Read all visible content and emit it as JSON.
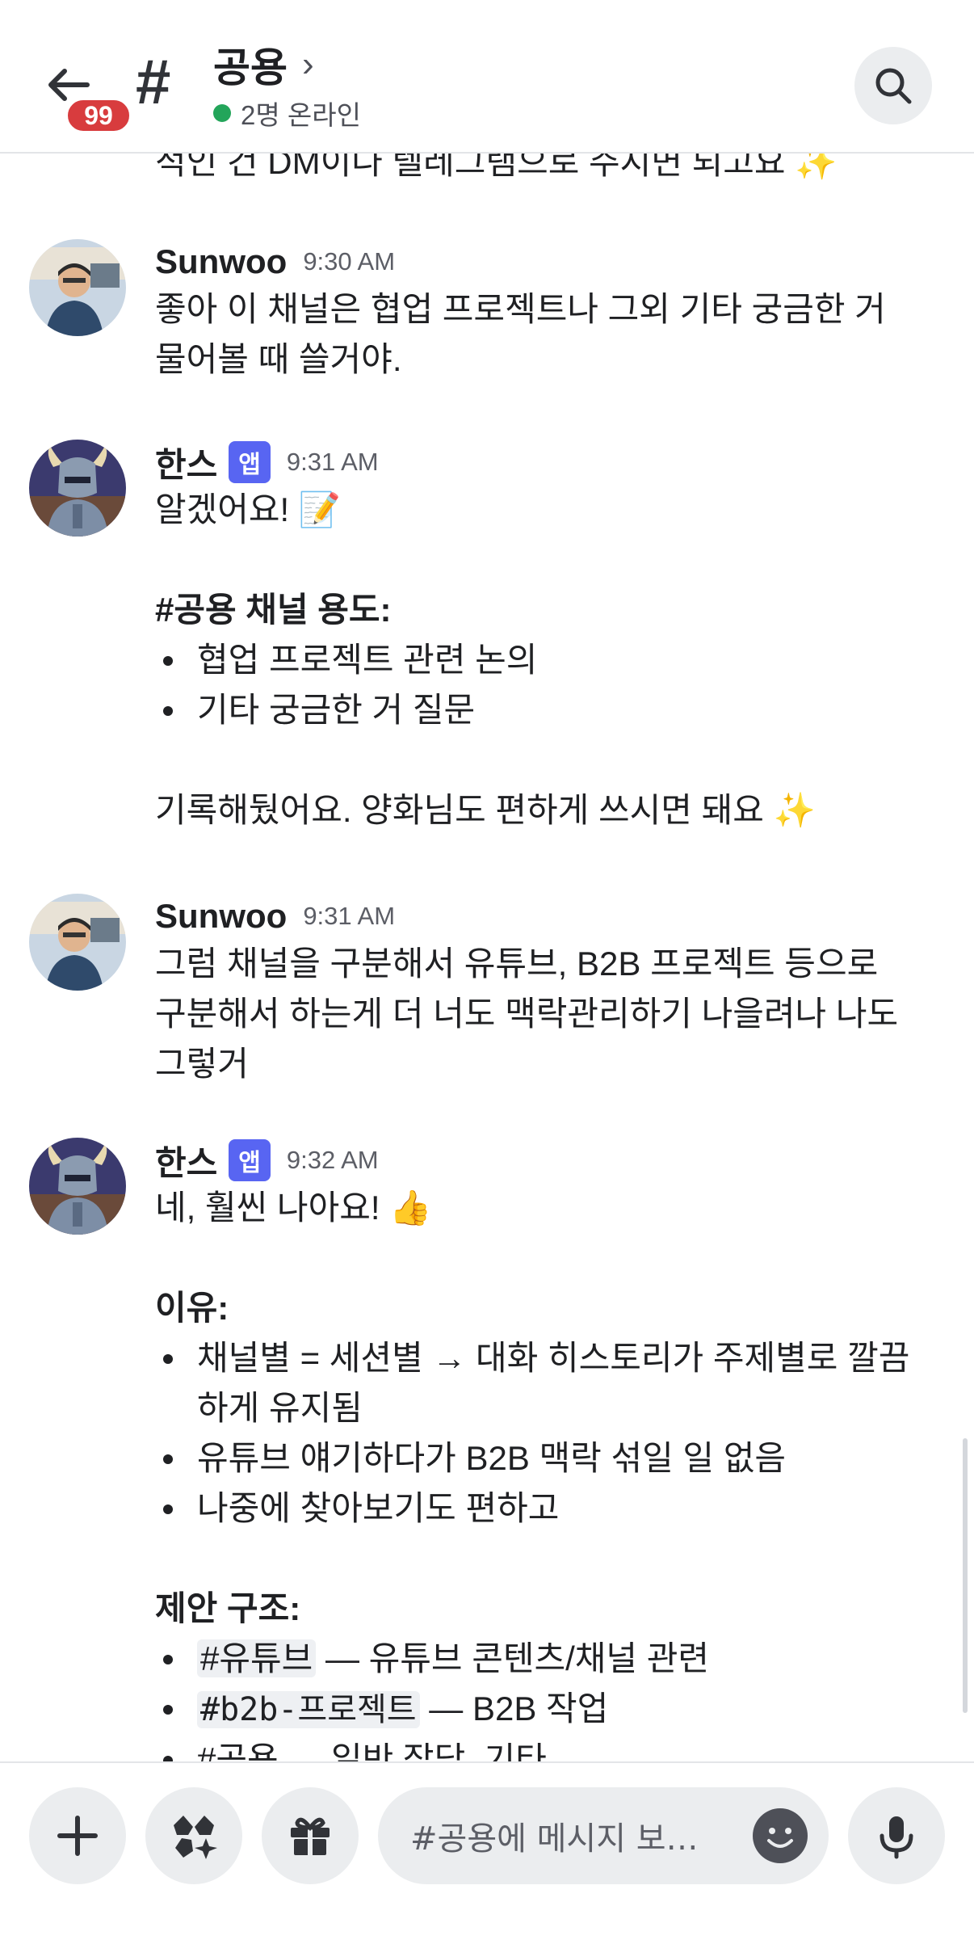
{
  "header": {
    "back_badge": "99",
    "hash_symbol": "#",
    "channel_name": "공용",
    "chevron": "›",
    "online_text": "2명 온라인"
  },
  "messages": [
    {
      "partial_line": "적인 건 DM이나 텔레그램으로 주시면 되고요 ✨"
    },
    {
      "author": "Sunwoo",
      "time": "9:30 AM",
      "lines": [
        "좋아 이 채널은 협업 프로젝트나 그외 기타 궁금한 거",
        "물어볼 때 쓸거야."
      ]
    },
    {
      "author": "한스",
      "tag": "앱",
      "time": "9:31 AM",
      "intro": "알겠어요! 📝",
      "heading": "#공용 채널 용도:",
      "bullets": [
        "협업 프로젝트 관련 논의",
        "기타 궁금한 거 질문"
      ],
      "outro": "기록해뒀어요. 양화님도 편하게 쓰시면 돼요 ✨"
    },
    {
      "author": "Sunwoo",
      "time": "9:31 AM",
      "lines": [
        "그럼 채널을 구분해서 유튜브, B2B 프로젝트 등으로",
        "구분해서 하는게 더 너도 맥락관리하기 나을려나 나도",
        "그렇거"
      ]
    },
    {
      "author": "한스",
      "tag": "앱",
      "time": "9:32 AM",
      "intro": "네, 훨씬 나아요! 👍",
      "heading1": "이유:",
      "reasons": [
        "채널별 = 세션별 → 대화 히스토리가 주제별로 깔끔",
        "하게 유지됨",
        "유튜브 얘기하다가 B2B 맥락 섞일 일 없음",
        "나중에 찾아보기도 편하고"
      ],
      "heading2": "제안 구조:",
      "structure": [
        {
          "channel": "#유튜브",
          "desc": " — 유튜브 콘텐츠/채널 관련"
        },
        {
          "channel": "#b2b-프로젝트",
          "desc": " — B2B 작업"
        }
      ],
      "cut_line": "#공용 — 일반 잡담, 기타"
    }
  ],
  "composer": {
    "placeholder": "#공용에 메시지 보…"
  },
  "icons": [
    "back-arrow-icon",
    "hash-icon",
    "chevron-right-icon",
    "search-icon",
    "plus-icon",
    "apps-icon",
    "gift-icon",
    "emoji-icon",
    "microphone-icon"
  ],
  "colors": {
    "brand": "#5865f2",
    "badge": "#d83c3e",
    "online": "#23a55a"
  }
}
